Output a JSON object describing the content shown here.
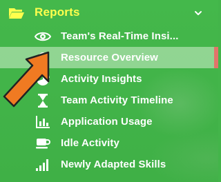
{
  "section": {
    "title": "Reports",
    "folder_icon": "folder-open-icon",
    "chevron_icon": "chevron-down-icon"
  },
  "items": [
    {
      "label": "Team's Real-Time Insi...",
      "icon": "eye-icon",
      "active": false
    },
    {
      "label": "Resource Overview",
      "icon": "dashboard-icon",
      "active": true
    },
    {
      "label": "Activity Insights",
      "icon": "pie-chart-icon",
      "active": false
    },
    {
      "label": "Team Activity Timeline",
      "icon": "hourglass-icon",
      "active": false
    },
    {
      "label": "Application Usage",
      "icon": "bar-chart-icon",
      "active": false
    },
    {
      "label": "Idle Activity",
      "icon": "coffee-icon",
      "active": false
    },
    {
      "label": "Newly Adapted Skills",
      "icon": "signal-bars-icon",
      "active": false
    }
  ],
  "colors": {
    "background": "#43b54a",
    "section_title": "#ffff4d",
    "item_text": "#ffffff",
    "active_bar": "#e2746a",
    "annotation_arrow": "#f07a22"
  },
  "annotation": {
    "icon": "arrow-pointer-icon"
  }
}
